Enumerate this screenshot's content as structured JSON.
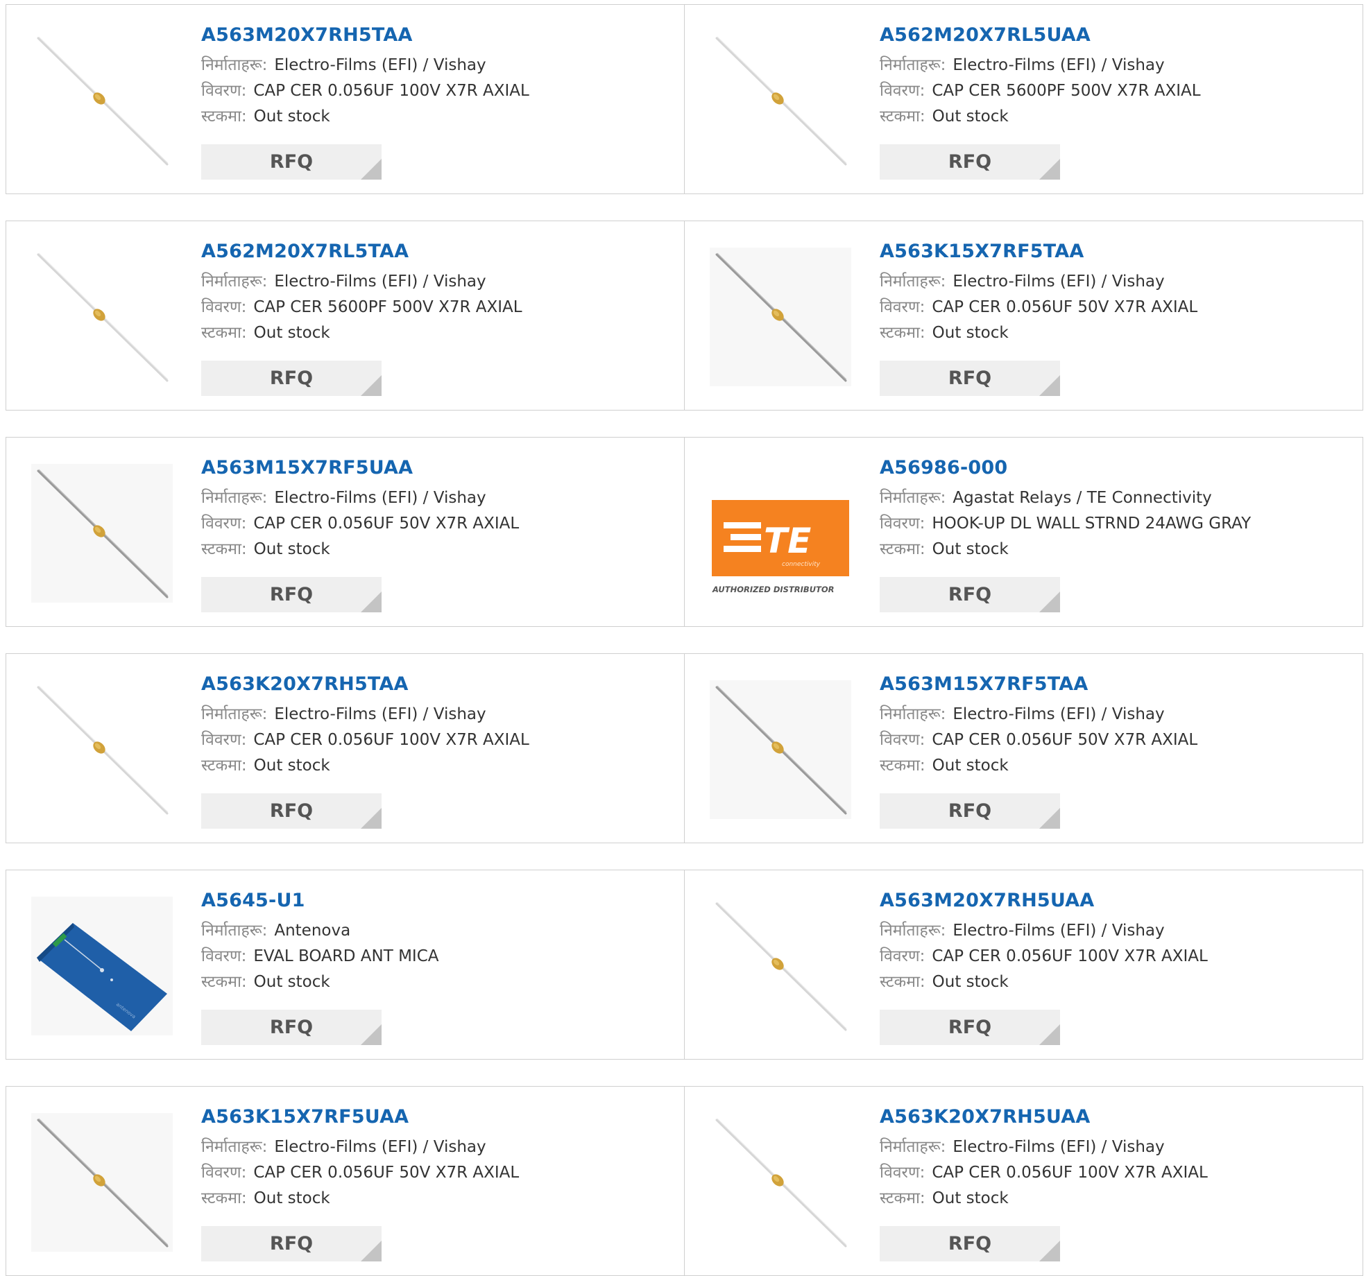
{
  "labels": {
    "manufacturer": "निर्माताहरू:",
    "description": "विवरण:",
    "stock": "स्टकमा:",
    "rfq": "RFQ"
  },
  "colors": {
    "part_link": "#1565b0",
    "rfq_bg": "#efefef",
    "border": "#cfcfcf",
    "te_orange": "#f58220"
  },
  "products": [
    {
      "part": "A563M20X7RH5TAA",
      "manufacturer": "Electro-Films (EFI) / Vishay",
      "description": "CAP CER 0.056UF 100V X7R AXIAL",
      "stock": "Out stock",
      "image": "axial-capacitor-icon"
    },
    {
      "part": "A562M20X7RL5UAA",
      "manufacturer": "Electro-Films (EFI) / Vishay",
      "description": "CAP CER 5600PF 500V X7R AXIAL",
      "stock": "Out stock",
      "image": "axial-capacitor-icon"
    },
    {
      "part": "A562M20X7RL5TAA",
      "manufacturer": "Electro-Films (EFI) / Vishay",
      "description": "CAP CER 5600PF 500V X7R AXIAL",
      "stock": "Out stock",
      "image": "axial-capacitor-icon"
    },
    {
      "part": "A563K15X7RF5TAA",
      "manufacturer": "Electro-Films (EFI) / Vishay",
      "description": "CAP CER 0.056UF 50V X7R AXIAL",
      "stock": "Out stock",
      "image": "axial-capacitor-gray-icon"
    },
    {
      "part": "A563M15X7RF5UAA",
      "manufacturer": "Electro-Films (EFI) / Vishay",
      "description": "CAP CER 0.056UF 50V X7R AXIAL",
      "stock": "Out stock",
      "image": "axial-capacitor-gray-icon"
    },
    {
      "part": "A56986-000",
      "manufacturer": "Agastat Relays / TE Connectivity",
      "description": "HOOK-UP DL WALL STRND 24AWG GRAY",
      "stock": "Out stock",
      "image": "te-connectivity-logo",
      "logo_caption": "AUTHORIZED DISTRIBUTOR",
      "logo_sub": "connectivity"
    },
    {
      "part": "A563K20X7RH5TAA",
      "manufacturer": "Electro-Films (EFI) / Vishay",
      "description": "CAP CER 0.056UF 100V X7R AXIAL",
      "stock": "Out stock",
      "image": "axial-capacitor-icon"
    },
    {
      "part": "A563M15X7RF5TAA",
      "manufacturer": "Electro-Films (EFI) / Vishay",
      "description": "CAP CER 0.056UF 50V X7R AXIAL",
      "stock": "Out stock",
      "image": "axial-capacitor-gray-icon"
    },
    {
      "part": "A5645-U1",
      "manufacturer": "Antenova",
      "description": "EVAL BOARD ANT MICA",
      "stock": "Out stock",
      "image": "eval-board-icon"
    },
    {
      "part": "A563M20X7RH5UAA",
      "manufacturer": "Electro-Films (EFI) / Vishay",
      "description": "CAP CER 0.056UF 100V X7R AXIAL",
      "stock": "Out stock",
      "image": "axial-capacitor-icon"
    },
    {
      "part": "A563K15X7RF5UAA",
      "manufacturer": "Electro-Films (EFI) / Vishay",
      "description": "CAP CER 0.056UF 50V X7R AXIAL",
      "stock": "Out stock",
      "image": "axial-capacitor-gray-icon"
    },
    {
      "part": "A563K20X7RH5UAA",
      "manufacturer": "Electro-Films (EFI) / Vishay",
      "description": "CAP CER 0.056UF 100V X7R AXIAL",
      "stock": "Out stock",
      "image": "axial-capacitor-icon"
    }
  ]
}
